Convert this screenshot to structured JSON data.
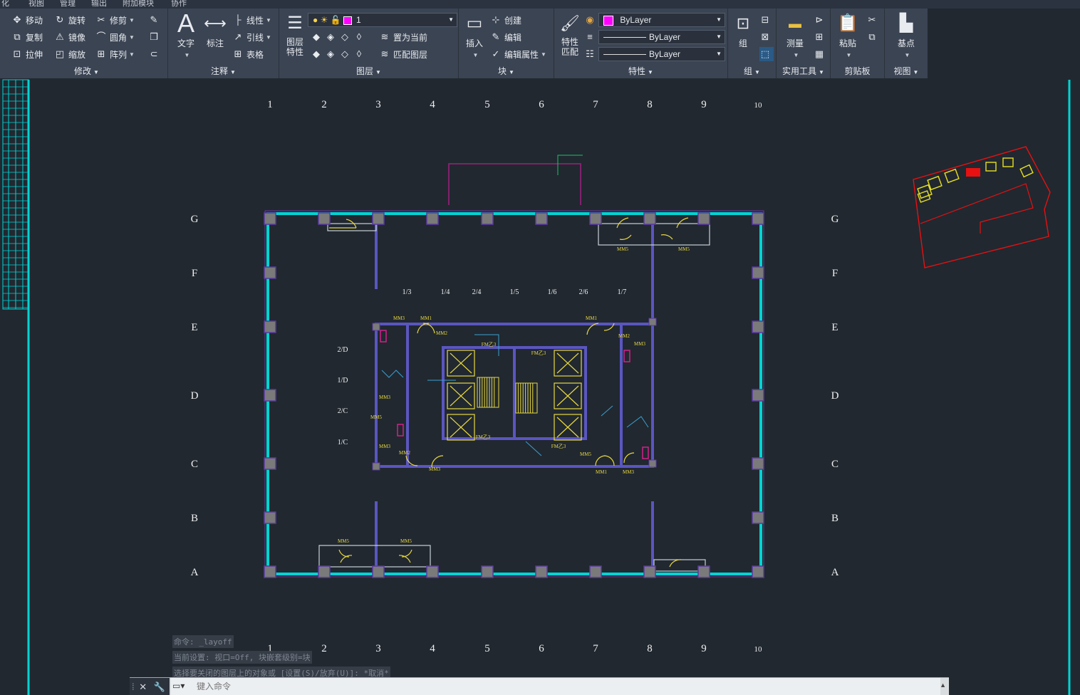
{
  "menu": [
    "化",
    "视图",
    "管理",
    "输出",
    "附加模块",
    "协作"
  ],
  "modify": {
    "title": "修改",
    "move": "移动",
    "rotate": "旋转",
    "trim": "修剪",
    "copy": "复制",
    "mirror": "镜像",
    "fillet": "圆角",
    "stretch": "拉伸",
    "scale": "缩放",
    "array": "阵列"
  },
  "annotation": {
    "title": "注释",
    "text": "文字",
    "dimension": "标注",
    "linear": "线性",
    "leader": "引线",
    "table": "表格"
  },
  "layers": {
    "title": "图层",
    "properties": "图层\n特性",
    "props1": "图层",
    "props2": "特性",
    "current_layer": "1",
    "set_current": "置为当前",
    "match_layer": "匹配图层",
    "layer_color": "#ff00ff"
  },
  "block": {
    "title": "块",
    "insert": "插入",
    "create": "创建",
    "edit": "编辑",
    "edit_attr": "编辑属性"
  },
  "properties": {
    "title": "特性",
    "match1": "特性",
    "match2": "匹配",
    "color": "ByLayer",
    "linetype": "ByLayer",
    "lineweight": "ByLayer"
  },
  "groups": {
    "title": "组",
    "group": "组"
  },
  "utilities": {
    "title": "实用工具",
    "measure": "测量"
  },
  "clipboard": {
    "title": "剪贴板",
    "paste": "粘贴"
  },
  "view": {
    "title": "视图",
    "basepoint": "基点"
  },
  "grid": {
    "columns": [
      "1",
      "2",
      "3",
      "4",
      "5",
      "6",
      "7",
      "8",
      "9",
      "10"
    ],
    "rows": [
      "G",
      "F",
      "E",
      "D",
      "C",
      "B",
      "A"
    ]
  },
  "core_labels": {
    "sub_cols": [
      "1/3",
      "1/4",
      "2/4",
      "1/5",
      "1/6",
      "2/6",
      "1/7"
    ],
    "sub_rows": [
      "2/D",
      "1/D",
      "2/C",
      "1/C"
    ]
  },
  "room_tags": [
    "MM5",
    "MM5",
    "MM3",
    "MM1",
    "MM3",
    "MM1",
    "MM2",
    "MM3",
    "FM乙3",
    "FM乙3",
    "FM乙3",
    "FM乙3",
    "MM5",
    "MM5",
    "MM3",
    "MM2",
    "MM3",
    "MM1",
    "MM3",
    "MM2",
    "MM5",
    "MM5"
  ],
  "cmd_history": [
    "命令: _layoff",
    "当前设置: 视口=Off, 块嵌套级别=块",
    "选择要关闭的图层上的对象或 [设置(S)/放弃(U)]: *取消*"
  ],
  "cmd_placeholder": "键入命令"
}
